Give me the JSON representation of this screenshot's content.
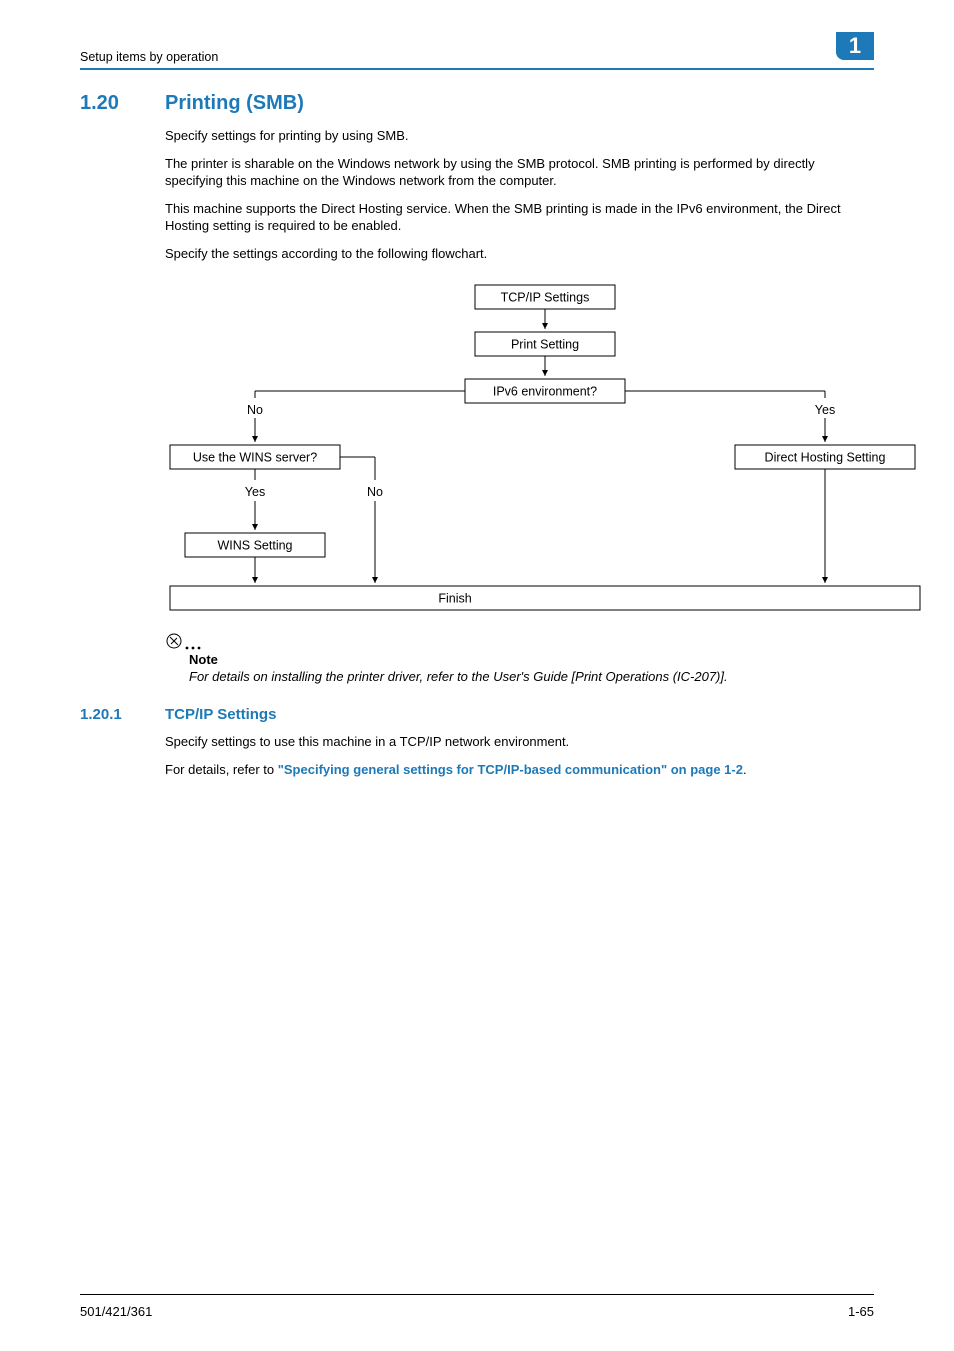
{
  "header": {
    "running": "Setup items by operation",
    "chapter_num": "1"
  },
  "section": {
    "number": "1.20",
    "title": "Printing (SMB)",
    "paragraphs": [
      "Specify settings for printing by using SMB.",
      "The printer is sharable on the Windows network by using the SMB protocol. SMB printing is performed by directly specifying this machine on the Windows network from the computer.",
      "This machine supports the Direct Hosting service. When the SMB printing is made in the IPv6 environment, the Direct Hosting setting is required to be enabled.",
      "Specify the settings according to the following flowchart."
    ]
  },
  "flowchart": {
    "tcpip": "TCP/IP Settings",
    "print_setting": "Print Setting",
    "ipv6_q": "IPv6 environment?",
    "no_label": "No",
    "yes_label": "Yes",
    "wins_q": "Use the WINS server?",
    "direct_hosting": "Direct Hosting Setting",
    "wins_yes": "Yes",
    "wins_no": "No",
    "wins_setting": "WINS Setting",
    "finish": "Finish"
  },
  "note": {
    "title": "Note",
    "body": "For details on installing the printer driver, refer to the User's Guide [Print Operations (IC-207)]."
  },
  "subsection": {
    "number": "1.20.1",
    "title": "TCP/IP Settings",
    "para1": "Specify settings to use this machine in a TCP/IP network environment.",
    "para2_prefix": "For details, refer to ",
    "para2_link": "\"Specifying general settings for TCP/IP-based communication\" on page 1-2",
    "para2_suffix": "."
  },
  "footer": {
    "left": "501/421/361",
    "right": "1-65"
  }
}
